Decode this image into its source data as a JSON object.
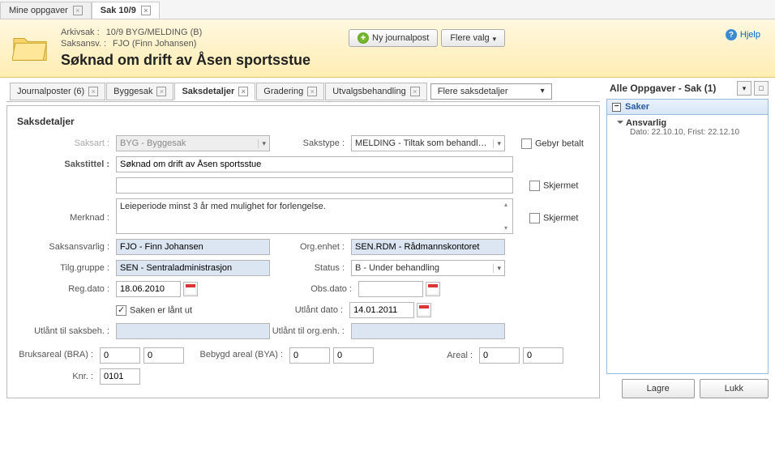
{
  "topTabs": [
    {
      "label": "Mine oppgaver",
      "active": false
    },
    {
      "label": "Sak 10/9",
      "active": true
    }
  ],
  "header": {
    "arkivsak_label": "Arkivsak :",
    "arkivsak_value": "10/9 BYG/MELDING (B)",
    "saksansv_label": "Saksansv. :",
    "saksansv_value": "FJO (Finn Johansen)",
    "title": "Søknad om drift av Åsen sportsstue",
    "btn_nyjp": "Ny journalpost",
    "btn_flere": "Flere valg",
    "help": "Hjelp"
  },
  "innerTabs": [
    "Journalposter (6)",
    "Byggesak",
    "Saksdetaljer",
    "Gradering",
    "Utvalgsbehandling"
  ],
  "innerDropdown": "Flere saksdetaljer",
  "panelTitle": "Saksdetaljer",
  "form": {
    "saksart_label": "Saksart :",
    "saksart_value": "BYG - Byggesak",
    "sakstype_label": "Sakstype :",
    "sakstype_value": "MELDING - Tiltak som behandles etter",
    "gebyr_label": "Gebyr betalt",
    "sakstittel_label": "Sakstittel :",
    "sakstittel_value": "Søknad om drift av Åsen sportsstue",
    "sakstittel2_value": "",
    "skjermet_label": "Skjermet",
    "merknad_label": "Merknad :",
    "merknad_value": "Leieperiode minst 3 år med mulighet for forlengelse.",
    "saksansvarlig_label": "Saksansvarlig :",
    "saksansvarlig_value": "FJO - Finn Johansen",
    "orgenhet_label": "Org.enhet :",
    "orgenhet_value": "SEN.RDM - Rådmannskontoret",
    "tilggruppe_label": "Tilg.gruppe :",
    "tilggruppe_value": "SEN - Sentraladministrasjon",
    "status_label": "Status :",
    "status_value": "B - Under behandling",
    "regdato_label": "Reg.dato :",
    "regdato_value": "18.06.2010",
    "obsdato_label": "Obs.dato :",
    "obsdato_value": "",
    "saken_label": "Saken er lånt ut",
    "utlantdato_label": "Utlånt dato :",
    "utlantdato_value": "14.01.2011",
    "utlant_saksbeh_label": "Utlånt til saksbeh. :",
    "utlant_saksbeh_value": "",
    "utlant_orgenh_label": "Utlånt til org.enh. :",
    "utlant_orgenh_value": "",
    "bruksareal_label": "Bruksareal (BRA) :",
    "bruksareal_v1": "0",
    "bruksareal_v2": "0",
    "bebygd_label": "Bebygd areal (BYA) :",
    "bebygd_v1": "0",
    "bebygd_v2": "0",
    "areal_label": "Areal :",
    "areal_v1": "0",
    "areal_v2": "0",
    "knr_label": "Knr. :",
    "knr_value": "0101"
  },
  "side": {
    "title": "Alle Oppgaver - Sak (1)",
    "section": "Saker",
    "item_name": "Ansvarlig",
    "item_detail": "Dato: 22.10.10, Frist: 22.12.10"
  },
  "buttons": {
    "lagre": "Lagre",
    "lukk": "Lukk"
  }
}
